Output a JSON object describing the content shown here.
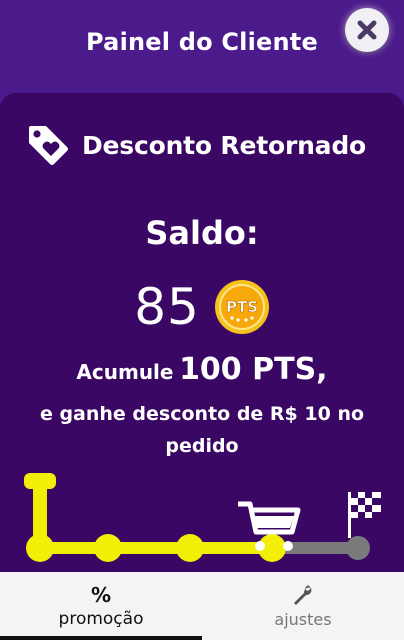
{
  "header": {
    "title": "Painel do Cliente"
  },
  "section": {
    "title": "Desconto Retornado",
    "icon": "tag-heart-icon"
  },
  "balance": {
    "label": "Saldo:",
    "points": "85",
    "coin_label": "PTS"
  },
  "goal": {
    "prefix": "Acumule",
    "amount": "100 PTS,",
    "description": "e ganhe desconto de R$ 10 no pedido",
    "progress": 0.85
  },
  "tabs": [
    {
      "icon": "%",
      "label": "promoção",
      "active": true
    },
    {
      "icon": "wrench-icon",
      "label": "ajustes",
      "active": false
    }
  ],
  "colors": {
    "header": "#4b1a8b",
    "card": "#3a0764",
    "progress_fill": "#f2ee05",
    "progress_track": "#7a7a7a",
    "coin": "#f4b400"
  }
}
